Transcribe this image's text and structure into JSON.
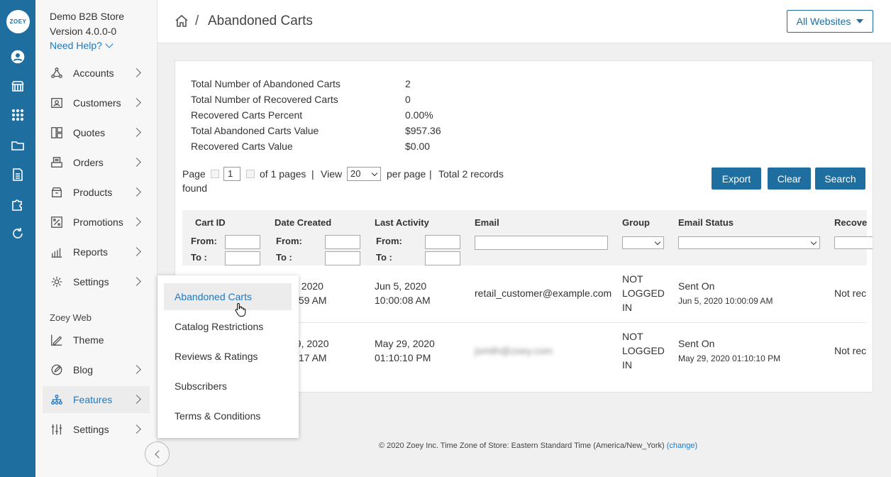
{
  "rail": {
    "logo": "ZOEY",
    "icons": [
      "user-circle-icon",
      "storefront-icon",
      "apps-grid-icon",
      "folder-icon",
      "document-icon",
      "puzzle-icon",
      "refresh-icon"
    ]
  },
  "sidebar": {
    "store_name": "Demo B2B Store",
    "version": "Version 4.0.0-0",
    "need_help": "Need Help?",
    "items": [
      {
        "label": "Accounts",
        "icon": "accounts-icon"
      },
      {
        "label": "Customers",
        "icon": "customers-icon"
      },
      {
        "label": "Quotes",
        "icon": "quotes-icon"
      },
      {
        "label": "Orders",
        "icon": "orders-icon"
      },
      {
        "label": "Products",
        "icon": "products-icon"
      },
      {
        "label": "Promotions",
        "icon": "percent-icon"
      },
      {
        "label": "Reports",
        "icon": "bar-chart-icon"
      },
      {
        "label": "Settings",
        "icon": "gear-icon"
      }
    ],
    "section_label": "Zoey Web",
    "web_items": [
      {
        "label": "Theme",
        "icon": "theme-icon"
      },
      {
        "label": "Blog",
        "icon": "blog-icon"
      },
      {
        "label": "Features",
        "icon": "features-icon"
      },
      {
        "label": "Settings",
        "icon": "sliders-icon"
      }
    ]
  },
  "header": {
    "page_title": "Abandoned Carts",
    "separator": "/",
    "website_select": "All Websites"
  },
  "stats": [
    {
      "label": "Total Number of Abandoned Carts",
      "value": "2"
    },
    {
      "label": "Total Number of Recovered Carts",
      "value": "0"
    },
    {
      "label": "Recovered Carts Percent",
      "value": "0.00%"
    },
    {
      "label": "Total Abandoned Carts Value",
      "value": "$957.36"
    },
    {
      "label": "Recovered Carts Value",
      "value": "$0.00"
    }
  ],
  "pager": {
    "page_label": "Page",
    "page_value": "1",
    "of_pages": "of 1 pages",
    "sep1": "|",
    "view_label": "View",
    "view_value": "20",
    "per_page": "per page",
    "sep2": "|",
    "total_records_a": "Total 2 records",
    "total_records_b": "found"
  },
  "actions": {
    "export": "Export",
    "clear": "Clear",
    "search": "Search"
  },
  "columns": [
    "Cart ID",
    "Date Created",
    "Last Activity",
    "Email",
    "Group",
    "Email Status",
    "Recove"
  ],
  "filters": {
    "from": "From:",
    "to": "To :"
  },
  "rows": [
    {
      "date_created_a": ", 2020",
      "date_created_b": ":59 AM",
      "last_activity_a": "Jun 5, 2020",
      "last_activity_b": "10:00:08 AM",
      "email": "retail_customer@example.com",
      "group_a": "NOT",
      "group_b": "LOGGED",
      "group_c": "IN",
      "status": "Sent On",
      "status_date": "Jun 5, 2020 10:00:09 AM",
      "recovered": "Not rec"
    },
    {
      "date_created_a": "29, 2020",
      "date_created_b": ":17 AM",
      "last_activity_a": "May 29, 2020",
      "last_activity_b": "01:10:10 PM",
      "email": "jsmith@zoey.com",
      "group_a": "NOT",
      "group_b": "LOGGED",
      "group_c": "IN",
      "status": "Sent On",
      "status_date": "May 29, 2020 01:10:10 PM",
      "recovered": "Not rec"
    }
  ],
  "flyout": {
    "items": [
      "Abandoned Carts",
      "Catalog Restrictions",
      "Reviews & Ratings",
      "Subscribers",
      "Terms & Conditions"
    ]
  },
  "footer": {
    "text": "© 2020 Zoey Inc. Time Zone of Store: Eastern Standard Time (America/New_York)",
    "change_link": "(change)"
  },
  "colors": {
    "rail": "#1e6fa0",
    "accent": "#1e79c2",
    "button": "#1e6fa0"
  }
}
